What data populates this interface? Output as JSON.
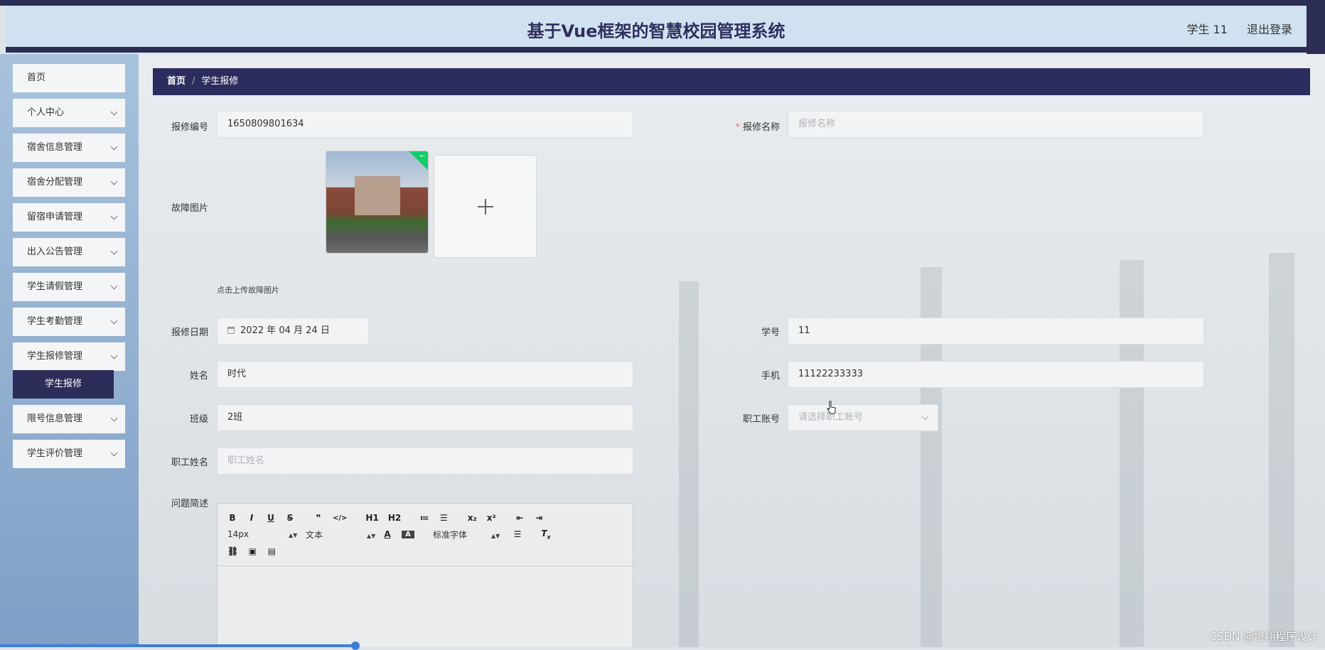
{
  "header": {
    "title": "基于Vue框架的智慧校园管理系统",
    "user": "学生 11",
    "logout": "退出登录"
  },
  "sidebar": {
    "items": [
      {
        "label": "首页"
      },
      {
        "label": "个人中心"
      },
      {
        "label": "宿舍信息管理"
      },
      {
        "label": "宿舍分配管理"
      },
      {
        "label": "留宿申请管理"
      },
      {
        "label": "出入公告管理"
      },
      {
        "label": "学生请假管理"
      },
      {
        "label": "学生考勤管理"
      },
      {
        "label": "学生报修管理"
      },
      {
        "label": "限号信息管理"
      },
      {
        "label": "学生评价管理"
      }
    ],
    "active_sub": "学生报修"
  },
  "breadcrumb": {
    "home": "首页",
    "sep": "/",
    "current": "学生报修"
  },
  "form": {
    "repair_no": {
      "label": "报修编号",
      "value": "1650809801634"
    },
    "repair_name": {
      "label": "报修名称",
      "placeholder": "报修名称"
    },
    "fault_image": {
      "label": "故障图片",
      "hint": "点击上传故障图片"
    },
    "repair_date": {
      "label": "报修日期",
      "value": "2022 年 04 月 24 日"
    },
    "student_no": {
      "label": "学号",
      "value": "11"
    },
    "name": {
      "label": "姓名",
      "value": "时代"
    },
    "phone": {
      "label": "手机",
      "value": "11122233333"
    },
    "class": {
      "label": "班级",
      "value": "2班"
    },
    "staff_account": {
      "label": "职工账号",
      "placeholder": "请选择职工账号"
    },
    "staff_name": {
      "label": "职工姓名",
      "placeholder": "职工姓名"
    },
    "description": {
      "label": "问题简述"
    }
  },
  "editor": {
    "font_size": "14px",
    "text_type": "文本",
    "font_family": "标准字体",
    "buttons": [
      "B",
      "I",
      "U",
      "S",
      "❞",
      "</>",
      "H1",
      "H2",
      "≔",
      "☰",
      "x₂",
      "x²",
      "⇤",
      "⇥"
    ]
  },
  "watermark": "CSDN @增翔程序设计"
}
